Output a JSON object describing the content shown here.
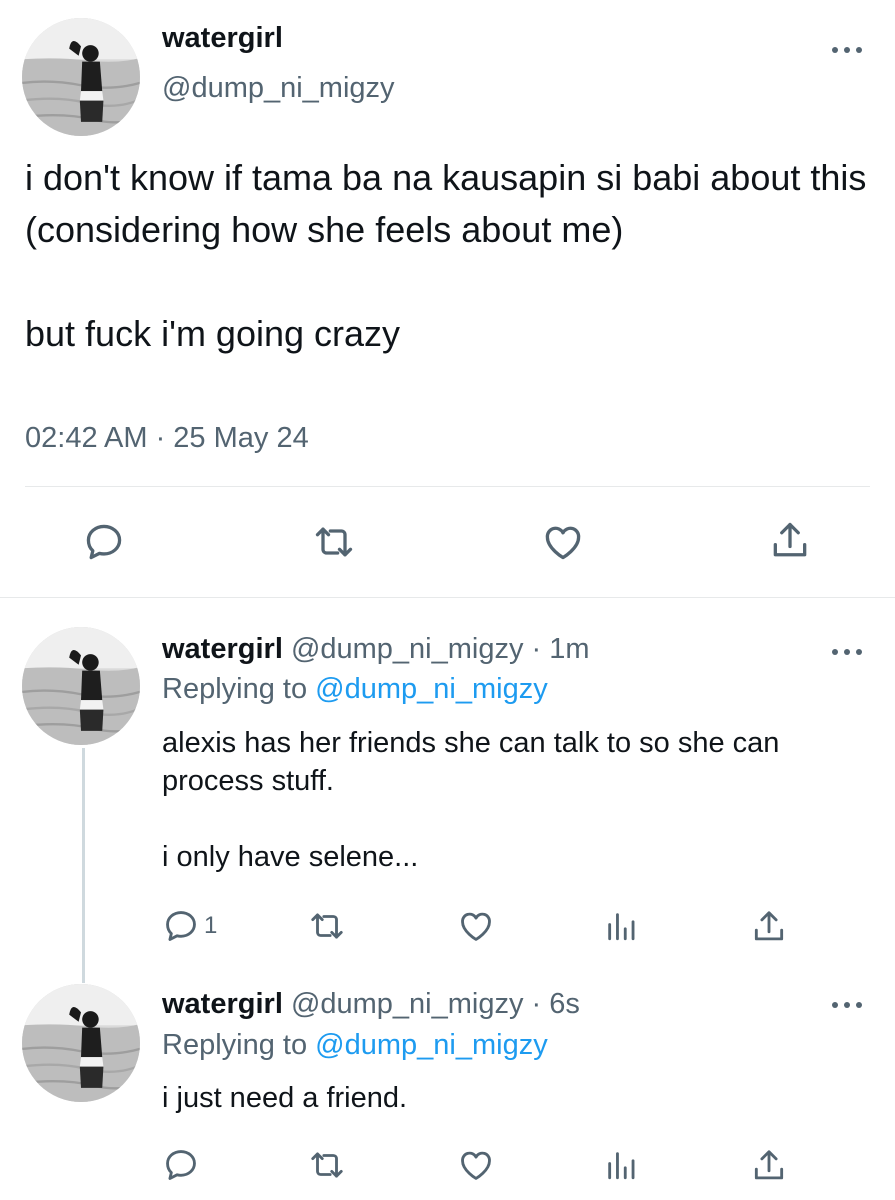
{
  "main_tweet": {
    "name": "watergirl",
    "handle": "@dump_ni_migzy",
    "text": "i don't know if tama ba na kausapin si babi about this (considering how she feels about me)\n\nbut fuck i'm going crazy",
    "timestamp": "02:42 AM · 25 May 24",
    "actions": [
      "reply-icon",
      "retweet-icon",
      "like-icon",
      "share-icon"
    ]
  },
  "replies": [
    {
      "name": "watergirl",
      "handle": "@dump_ni_migzy",
      "age": " · 1m",
      "replying_label": "Replying to ",
      "replying_to": "@dump_ni_migzy",
      "text": "alexis has her friends she can talk to so she can process stuff.\n\ni only have selene...",
      "reply_count": "1",
      "actions": [
        "reply-icon",
        "retweet-icon",
        "like-icon",
        "analytics-icon",
        "share-icon"
      ]
    },
    {
      "name": "watergirl",
      "handle": "@dump_ni_migzy",
      "age": " · 6s",
      "replying_label": "Replying to ",
      "replying_to": "@dump_ni_migzy",
      "text": "i just need a friend.",
      "reply_count": "",
      "actions": [
        "reply-icon",
        "retweet-icon",
        "like-icon",
        "analytics-icon",
        "share-icon"
      ]
    }
  ],
  "colors": {
    "text": "#0f1419",
    "secondary": "#536471",
    "link": "#1d9bf0",
    "divider": "#e7e9ea"
  }
}
